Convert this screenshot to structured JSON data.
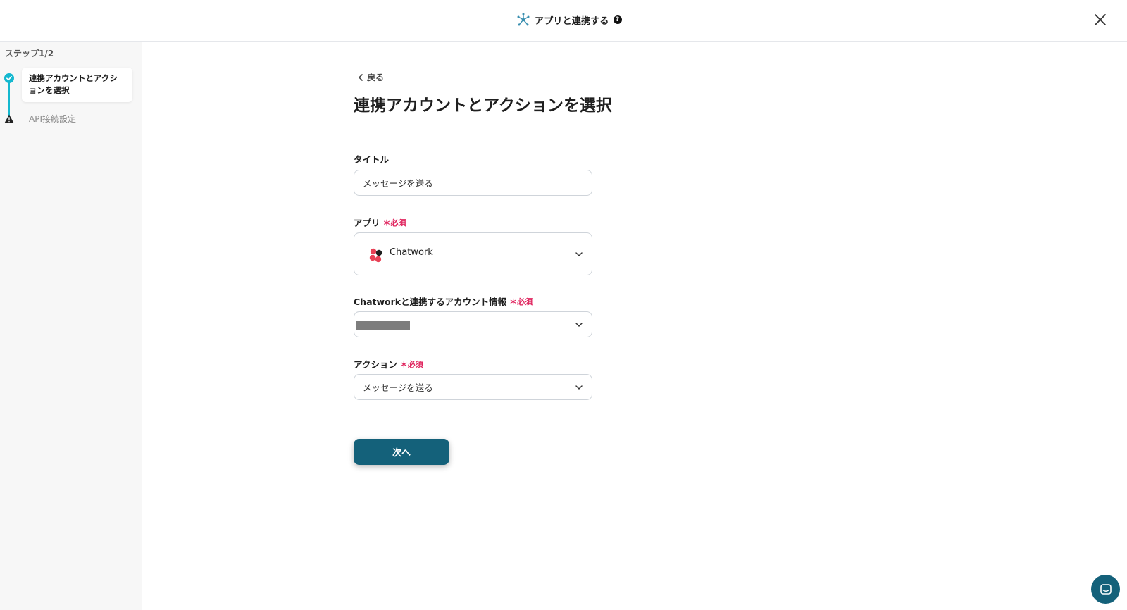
{
  "header": {
    "title": "アプリと連携する",
    "help_label": "?",
    "icon": "network-icon",
    "close_icon": "close-icon"
  },
  "sidebar": {
    "step_counter": "ステップ1/2",
    "steps": [
      {
        "label": "連携アカウントとアクションを選択",
        "status": "completed",
        "icon": "check-circle-icon"
      },
      {
        "label": "API接続設定",
        "status": "warning",
        "icon": "warning-icon"
      }
    ]
  },
  "main": {
    "back_label": "戻る",
    "page_title": "連携アカウントとアクションを選択",
    "required_label": "＊必須",
    "title_field": {
      "label": "タイトル",
      "value": "メッセージを送る"
    },
    "app_field": {
      "label": "アプリ",
      "value": "Chatwork",
      "icon": "chatwork-logo-icon"
    },
    "account_field": {
      "label": "Chatworkと連携するアカウント情報",
      "value": ""
    },
    "action_field": {
      "label": "アクション",
      "value": "メッセージを送る"
    },
    "next_label": "次へ"
  },
  "colors": {
    "accent": "#14b8cf",
    "primary_button": "#14617a",
    "required": "#e0245e"
  }
}
